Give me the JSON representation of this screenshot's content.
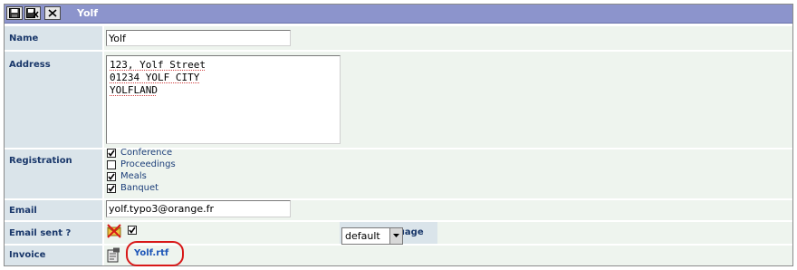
{
  "window": {
    "title": "Yolf"
  },
  "toolbar": {
    "buttons": [
      {
        "icon": "save-icon"
      },
      {
        "icon": "save-close-icon"
      },
      {
        "icon": "close-icon"
      }
    ]
  },
  "form": {
    "name": {
      "label": "Name",
      "value": "Yolf"
    },
    "address": {
      "label": "Address",
      "lines": [
        "123, Yolf Street",
        "01234 YOLF CITY",
        "YOLFLAND"
      ]
    },
    "registration": {
      "label": "Registration",
      "options": [
        {
          "label": "Conference",
          "checked": true
        },
        {
          "label": "Proceedings",
          "checked": false
        },
        {
          "label": "Meals",
          "checked": true
        },
        {
          "label": "Banquet",
          "checked": true
        }
      ]
    },
    "email": {
      "label": "Email",
      "value": "yolf.typo3@orange.fr"
    },
    "email_sent": {
      "label": "Email sent ?",
      "checked": true,
      "icon": "send-mail-icon"
    },
    "email_language": {
      "label": "Email language",
      "selected": "default"
    },
    "invoice": {
      "label": "Invoice",
      "file_link": "Yolf.rtf",
      "icon": "invoice-file-icon"
    }
  },
  "colors": {
    "titlebar": "#8c94cc",
    "label_bg": "#dae4ea",
    "value_bg": "#eef4ee",
    "label_text": "#19376a",
    "highlight": "#d81818"
  }
}
